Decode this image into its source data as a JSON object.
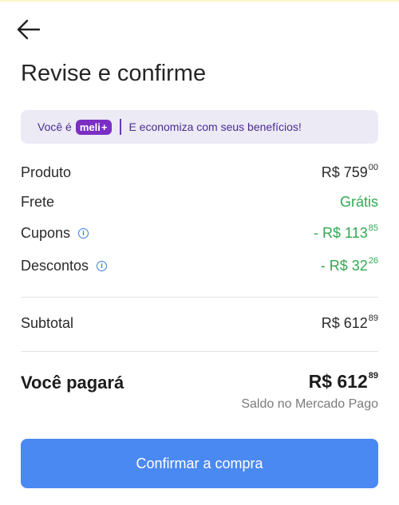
{
  "page": {
    "title": "Revise e confirme"
  },
  "banner": {
    "prefix": "Você é",
    "brand_name": "meli",
    "brand_plus": "+",
    "message": "E economiza com seus benefícios!"
  },
  "summary": {
    "items": [
      {
        "label": "Produto",
        "amount": "R$ 759",
        "cents": "00"
      },
      {
        "label": "Frete",
        "value": "Grátis"
      },
      {
        "label": "Cupons",
        "amount": "- R$ 113",
        "cents": "85"
      },
      {
        "label": "Descontos",
        "amount": "- R$ 32",
        "cents": "26"
      }
    ],
    "subtotal": {
      "label": "Subtotal",
      "amount": "R$ 612",
      "cents": "89"
    }
  },
  "total": {
    "label": "Você pagará",
    "amount": "R$ 612",
    "cents": "89",
    "payment_method": "Saldo no Mercado Pago"
  },
  "confirm_button": {
    "label": "Confirmar a compra"
  },
  "info_icon_glyph": "i",
  "colors": {
    "accent_blue": "#4a89f2",
    "green": "#33a852",
    "banner_bg": "#eceaf5",
    "meli_purple": "#7b2ec4"
  },
  "icons": {
    "back": "arrow-left-icon",
    "info": "info-icon"
  }
}
